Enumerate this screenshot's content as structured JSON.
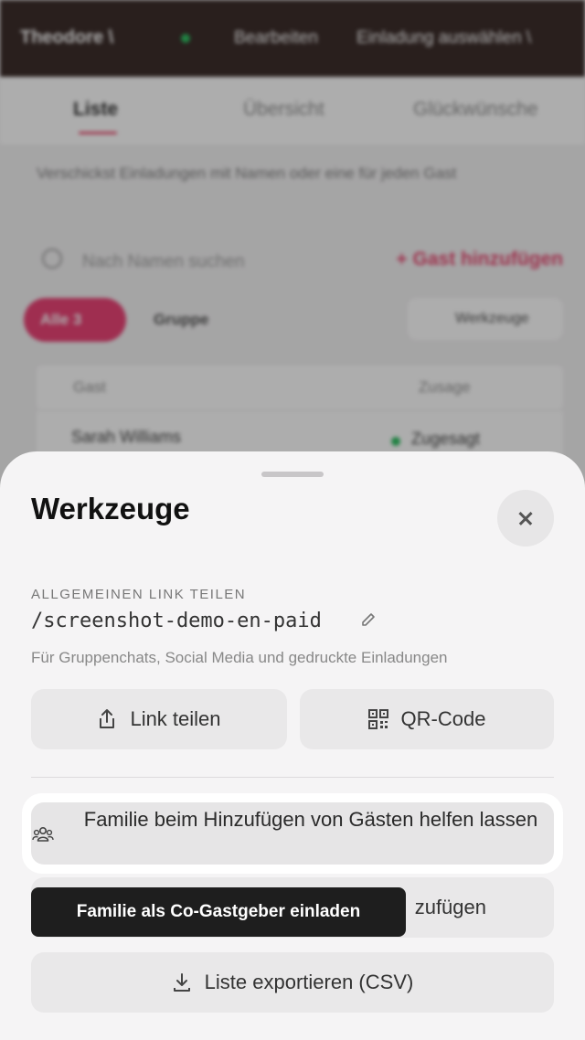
{
  "background": {
    "host_name": "Theodore \\",
    "edit_label": "Bearbeiten",
    "settings_label": "Einladung auswählen \\",
    "tabs": [
      "Liste",
      "Übersicht",
      "Glückwünsche"
    ],
    "hint": "Verschickst Einladungen mit Namen oder eine für jeden Gast",
    "search_placeholder": "Nach Namen suchen",
    "add_guest_label": "+  Gast hinzufügen",
    "filter_all": "Alle 3",
    "filter_group": "Gruppe",
    "tools_label": "Werkzeuge",
    "col_guest": "Gast",
    "col_rsvp": "Zusage",
    "row_name": "Sarah Williams",
    "row_status": "Zugesagt"
  },
  "sheet": {
    "title": "Werkzeuge",
    "close_icon": "close-icon",
    "general_link_label": "ALLGEMEINEN LINK TEILEN",
    "link_path": "/screenshot-demo-en-paid",
    "link_desc": "Für Gruppenchats, Social Media und gedruckte Einladungen",
    "share_label": "Link teilen",
    "qr_label": "QR-Code",
    "family_help_label": "Familie beim Hinzufügen von Gästen helfen lassen",
    "coguest_label_partial": "zufügen",
    "export_label": "Liste exportieren (CSV)",
    "tooltip": "Familie als Co-Gastgeber einladen"
  },
  "colors": {
    "accent": "#e8336a",
    "status_green": "#1db954",
    "topbar": "#2a1a17"
  }
}
